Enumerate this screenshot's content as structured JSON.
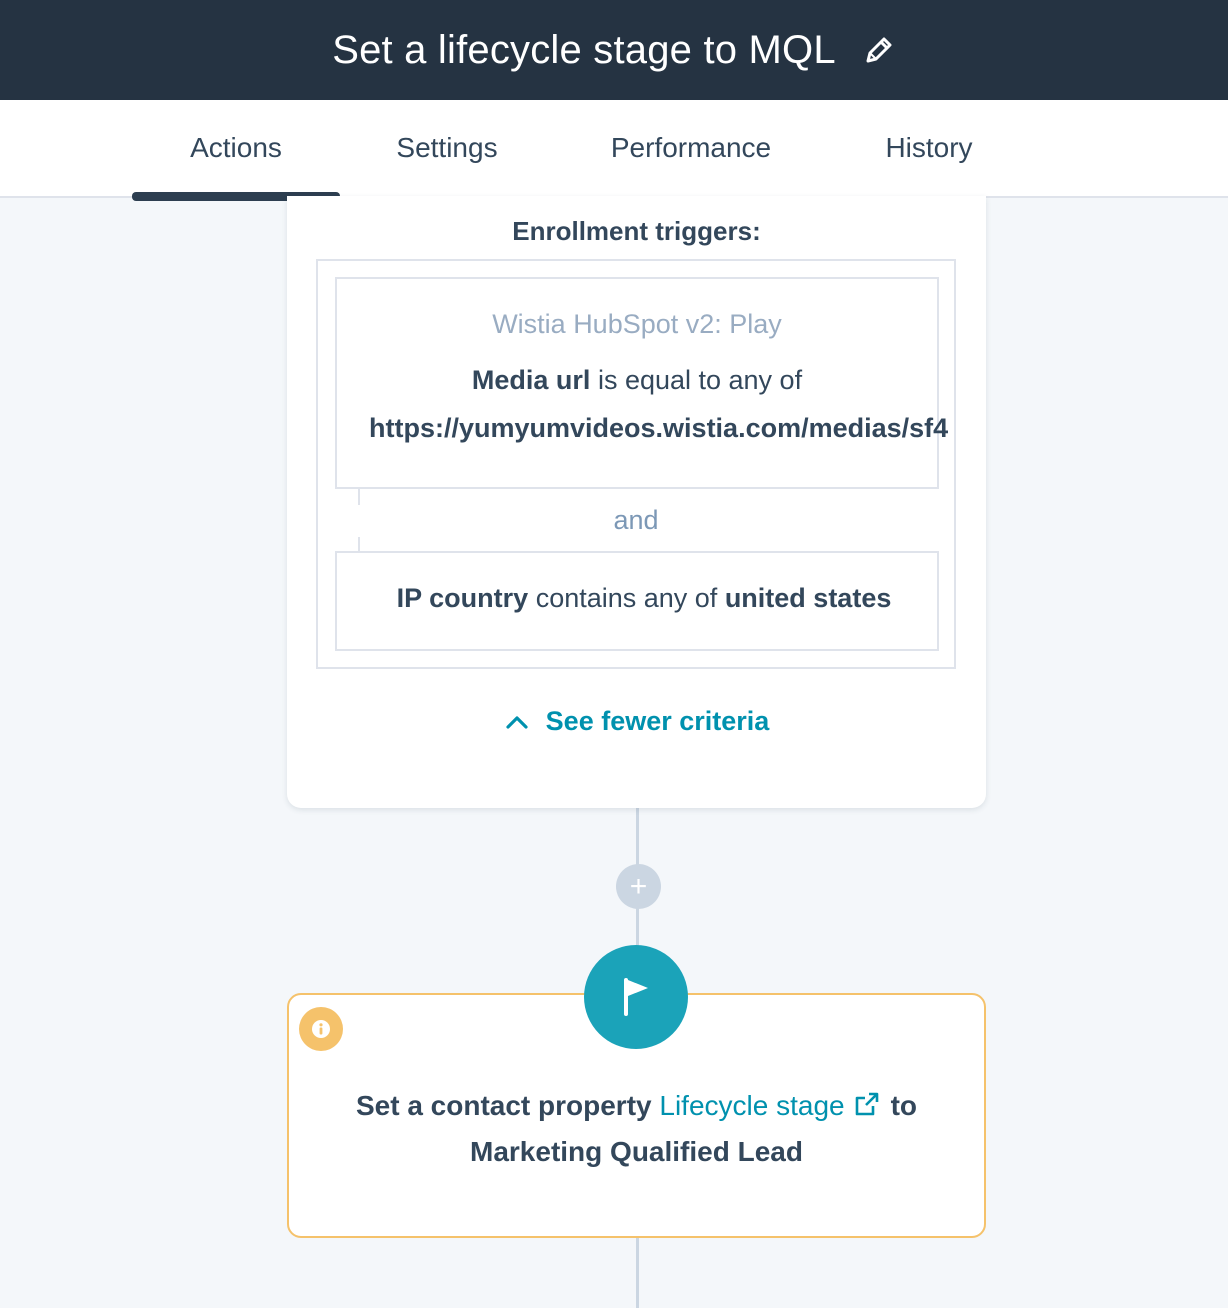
{
  "header": {
    "title": "Set a lifecycle stage to MQL",
    "edit_icon": "pencil-icon"
  },
  "tabs": [
    {
      "label": "Actions",
      "active": true
    },
    {
      "label": "Settings",
      "active": false
    },
    {
      "label": "Performance",
      "active": false
    },
    {
      "label": "History",
      "active": false
    }
  ],
  "trigger_card": {
    "heading": "Enrollment triggers:",
    "filter1": {
      "source": "Wistia HubSpot v2: Play",
      "property": "Media url",
      "operator": " is equal to any of",
      "value": "https://yumyumvideos.wistia.com/medias/sf4"
    },
    "joiner": "and",
    "filter2": {
      "property": "IP country",
      "operator": " contains any of ",
      "value": "united states"
    },
    "see_fewer": "See fewer criteria"
  },
  "plus_label": "+",
  "action_card": {
    "prefix": "Set a contact property ",
    "property_link": "Lifecycle stage",
    "suffix": "to",
    "value": "Marketing Qualified Lead"
  },
  "colors": {
    "header_bg": "#253342",
    "accent_teal": "#0091ae",
    "flag_circle": "#1ba3b9",
    "warning_border": "#f5c26b"
  }
}
